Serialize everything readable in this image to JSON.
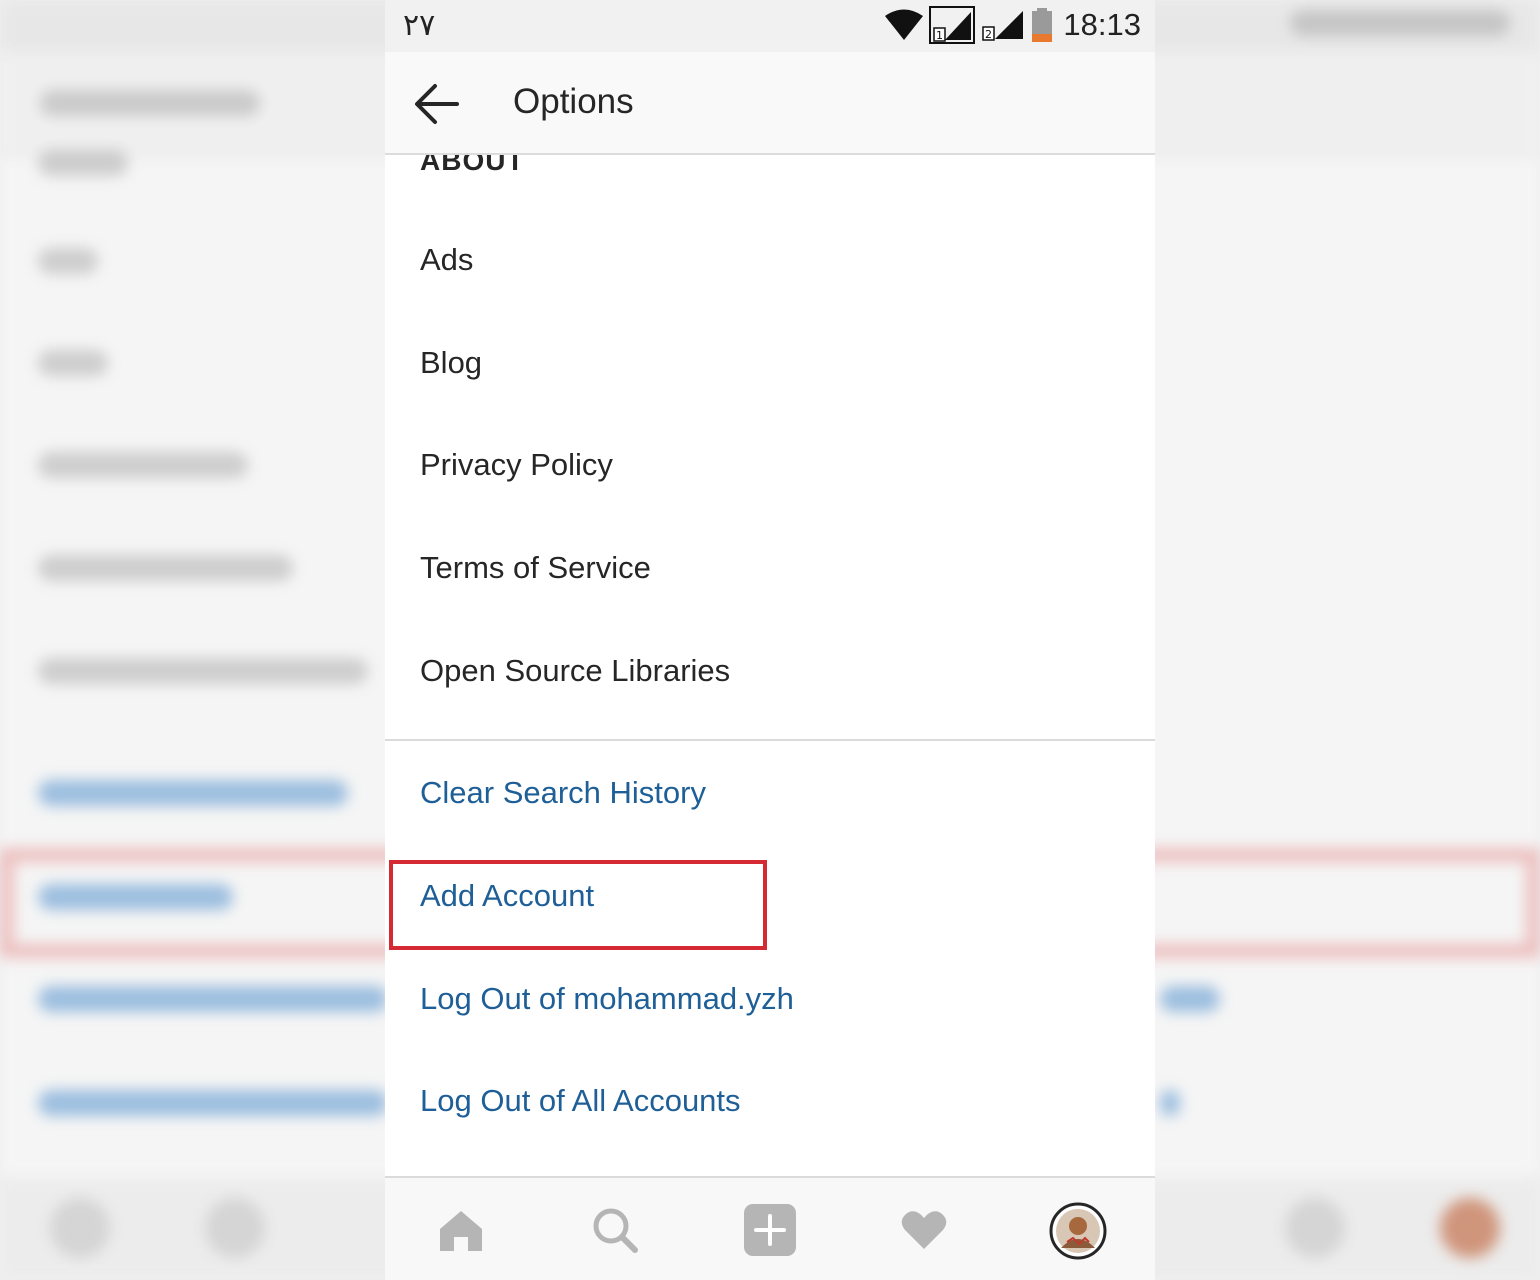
{
  "status_bar": {
    "date": "۲۷",
    "time": "18:13",
    "sim1": "1",
    "sim2": "2"
  },
  "header": {
    "title": "Options"
  },
  "section": {
    "header": "ABOUT"
  },
  "menu": {
    "about_items": [
      "Ads",
      "Blog",
      "Privacy Policy",
      "Terms of Service",
      "Open Source Libraries"
    ],
    "account_items": [
      "Clear Search History",
      "Add Account",
      "Log Out of mohammad.yzh",
      "Log Out of All Accounts"
    ]
  },
  "colors": {
    "link": "#1f5f97",
    "highlight": "#d52a33",
    "icon_gray": "#b5b5b5"
  },
  "tabbar": {
    "icons": [
      "home-icon",
      "search-icon",
      "add-post-icon",
      "heart-icon",
      "profile-avatar"
    ]
  }
}
